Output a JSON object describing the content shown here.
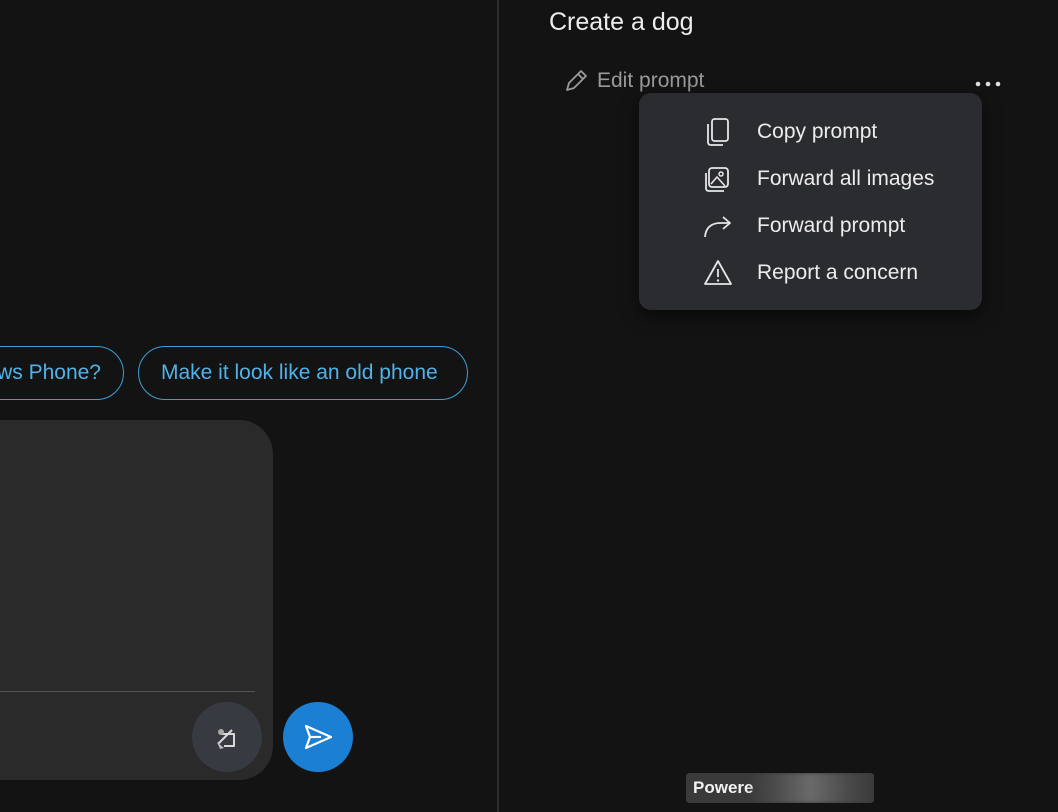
{
  "chat": {
    "suggestions": [
      {
        "label": "ows Phone?"
      },
      {
        "label": "Make it look like an old phone"
      }
    ]
  },
  "side_panel": {
    "title": "Create a dog",
    "edit_prompt_label": "Edit prompt",
    "menu": {
      "items": [
        {
          "label": "Copy prompt",
          "icon": "copy-icon"
        },
        {
          "label": "Forward all images",
          "icon": "image-icon"
        },
        {
          "label": "Forward prompt",
          "icon": "forward-arrow-icon"
        },
        {
          "label": "Report a concern",
          "icon": "warning-icon"
        }
      ]
    },
    "footer": {
      "powered_label": "Powere"
    }
  },
  "colors": {
    "accent": "#1b7fd4",
    "chip_text": "#4fb3ea",
    "background": "#131313",
    "menu_bg": "#2b2c2f"
  }
}
